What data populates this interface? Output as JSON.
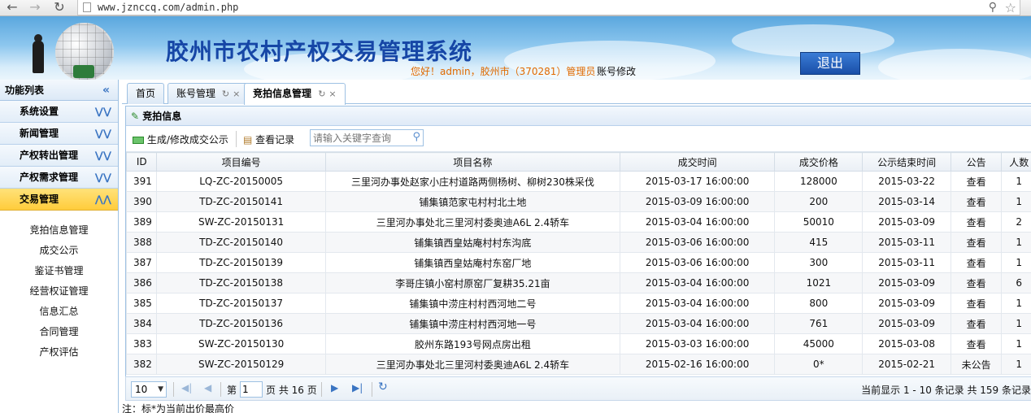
{
  "browser": {
    "url": "www.jznccq.com/admin.php"
  },
  "header": {
    "title": "胶州市农村产权交易管理系统",
    "welcome": "您好！admin，胶州市（370281）管理员",
    "account_link": "账号修改",
    "logout": "退出"
  },
  "sidebar": {
    "title": "功能列表",
    "groups": [
      {
        "label": "系统设置"
      },
      {
        "label": "新闻管理"
      },
      {
        "label": "产权转出管理"
      },
      {
        "label": "产权需求管理"
      },
      {
        "label": "交易管理"
      }
    ],
    "sub_items": [
      {
        "label": "竞拍信息管理"
      },
      {
        "label": "成交公示"
      },
      {
        "label": "鉴证书管理"
      },
      {
        "label": "经营权证管理"
      },
      {
        "label": "信息汇总"
      },
      {
        "label": "合同管理"
      },
      {
        "label": "产权评估"
      }
    ]
  },
  "tabs": [
    {
      "label": "首页"
    },
    {
      "label": "账号管理"
    },
    {
      "label": "竞拍信息管理"
    }
  ],
  "panel": {
    "title": "竞拍信息",
    "toolbar": {
      "generate": "生成/修改成交公示",
      "view_records": "查看记录",
      "search_placeholder": "请输入关键字查询"
    }
  },
  "table": {
    "columns": [
      "ID",
      "项目编号",
      "项目名称",
      "成交时间",
      "成交价格",
      "公示结束时间",
      "公告",
      "人数"
    ],
    "rows": [
      [
        "391",
        "LQ-ZC-20150005",
        "三里河办事处赵家小庄村道路两侧杨树、柳树230株采伐",
        "2015-03-17 16:00:00",
        "128000",
        "2015-03-22",
        "查看",
        "1"
      ],
      [
        "390",
        "TD-ZC-20150141",
        "铺集镇范家屯村村北土地",
        "2015-03-09 16:00:00",
        "200",
        "2015-03-14",
        "查看",
        "1"
      ],
      [
        "389",
        "SW-ZC-20150131",
        "三里河办事处北三里河村委奥迪A6L 2.4轿车",
        "2015-03-04 16:00:00",
        "50010",
        "2015-03-09",
        "查看",
        "2"
      ],
      [
        "388",
        "TD-ZC-20150140",
        "铺集镇西皇姑庵村村东沟底",
        "2015-03-06 16:00:00",
        "415",
        "2015-03-11",
        "查看",
        "1"
      ],
      [
        "387",
        "TD-ZC-20150139",
        "铺集镇西皇姑庵村东窑厂地",
        "2015-03-06 16:00:00",
        "300",
        "2015-03-11",
        "查看",
        "1"
      ],
      [
        "386",
        "TD-ZC-20150138",
        "李哥庄镇小窑村原窑厂复耕35.21亩",
        "2015-03-04 16:00:00",
        "1021",
        "2015-03-09",
        "查看",
        "6"
      ],
      [
        "385",
        "TD-ZC-20150137",
        "铺集镇中涝庄村村西河地二号",
        "2015-03-04 16:00:00",
        "800",
        "2015-03-09",
        "查看",
        "1"
      ],
      [
        "384",
        "TD-ZC-20150136",
        "铺集镇中涝庄村村西河地一号",
        "2015-03-04 16:00:00",
        "761",
        "2015-03-09",
        "查看",
        "1"
      ],
      [
        "383",
        "SW-ZC-20150130",
        "胶州东路193号网点房出租",
        "2015-03-03 16:00:00",
        "45000",
        "2015-03-08",
        "查看",
        "1"
      ],
      [
        "382",
        "SW-ZC-20150129",
        "三里河办事处北三里河村委奥迪A6L 2.4轿车",
        "2015-02-16 16:00:00",
        "0*",
        "2015-02-21",
        "未公告",
        "1"
      ]
    ]
  },
  "pager": {
    "page_size": "10",
    "page_label_before": "第",
    "page_value": "1",
    "page_label_after": "页 共 16 页",
    "info": "当前显示 1 - 10 条记录 共 159 条记录"
  },
  "note": "注：标*为当前出价最高价",
  "colors": {
    "accent": "#3a74c2",
    "title_blue": "#1646a6",
    "welcome_orange": "#e06a00",
    "active_group": "#ffcc3b",
    "unannounced_red": "#ee0000"
  }
}
